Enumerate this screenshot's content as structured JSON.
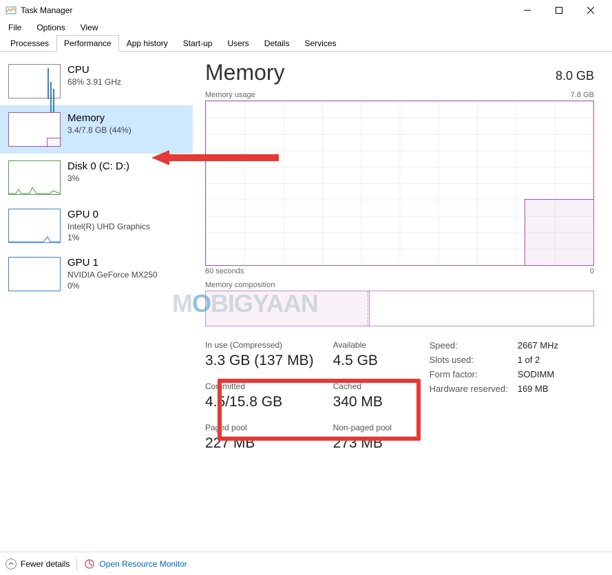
{
  "window": {
    "title": "Task Manager"
  },
  "menu": {
    "file": "File",
    "options": "Options",
    "view": "View"
  },
  "tabs": {
    "processes": "Processes",
    "performance": "Performance",
    "app_history": "App history",
    "startup": "Start-up",
    "users": "Users",
    "details": "Details",
    "services": "Services"
  },
  "sidebar": {
    "cpu": {
      "name": "CPU",
      "sub": "68%  3.91 GHz"
    },
    "mem": {
      "name": "Memory",
      "sub": "3.4/7.8 GB (44%)"
    },
    "disk": {
      "name": "Disk 0 (C: D:)",
      "sub": "3%"
    },
    "gpu0": {
      "name": "GPU 0",
      "sub1": "Intel(R) UHD Graphics",
      "sub2": "1%"
    },
    "gpu1": {
      "name": "GPU 1",
      "sub1": "NVIDIA GeForce MX250",
      "sub2": "0%"
    }
  },
  "detail": {
    "title": "Memory",
    "capacity": "8.0 GB",
    "usage_label": "Memory usage",
    "usage_max": "7.8 GB",
    "axis_left": "60 seconds",
    "axis_right": "0",
    "comp_label": "Memory composition",
    "stats": {
      "in_use_label": "In use (Compressed)",
      "in_use_value": "3.3 GB (137 MB)",
      "available_label": "Available",
      "available_value": "4.5 GB",
      "committed_label": "Committed",
      "committed_value": "4.5/15.8 GB",
      "cached_label": "Cached",
      "cached_value": "340 MB",
      "paged_label": "Paged pool",
      "paged_value": "227 MB",
      "nonpaged_label": "Non-paged pool",
      "nonpaged_value": "273 MB"
    },
    "right": {
      "speed_label": "Speed:",
      "speed_value": "2667 MHz",
      "slots_label": "Slots used:",
      "slots_value": "1 of 2",
      "form_label": "Form factor:",
      "form_value": "SODIMM",
      "hw_label": "Hardware reserved:",
      "hw_value": "169 MB"
    }
  },
  "footer": {
    "fewer": "Fewer details",
    "open_rm": "Open Resource Monitor"
  },
  "chart_data": {
    "type": "line",
    "title": "Memory usage",
    "xlabel": "seconds ago",
    "ylabel": "GB",
    "ylim": [
      0,
      7.8
    ],
    "xlim": [
      60,
      0
    ],
    "x": [
      60,
      12,
      11,
      0
    ],
    "values": [
      0,
      0,
      3.4,
      3.4
    ]
  },
  "watermark": "MOBIGYAAN"
}
